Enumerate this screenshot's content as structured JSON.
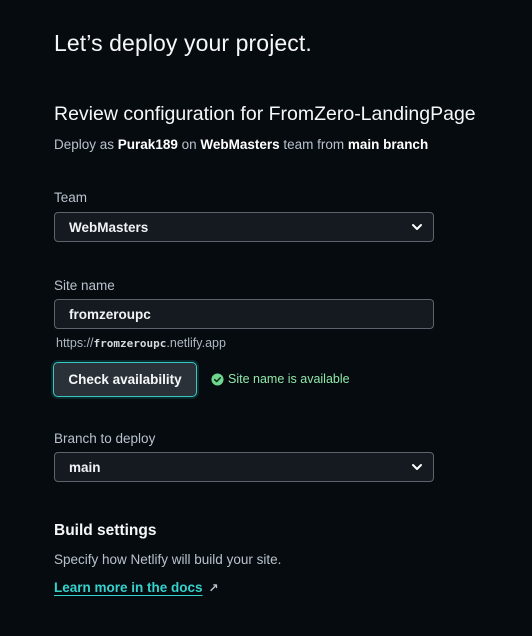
{
  "page": {
    "title": "Let’s deploy your project."
  },
  "review": {
    "heading": "Review configuration for FromZero-LandingPage",
    "deploy_prefix": "Deploy as ",
    "user": "Purak189",
    "on_text": " on ",
    "team": "WebMasters",
    "team_from_text": " team from ",
    "branch_text": "main branch"
  },
  "team_field": {
    "label": "Team",
    "value": "WebMasters",
    "icon": "chevron-down-icon"
  },
  "site_name_field": {
    "label": "Site name",
    "value": "fromzeroupc",
    "url_prefix": "https://",
    "url_name": "fromzeroupc",
    "url_suffix": ".netlify.app"
  },
  "check_availability": {
    "button_label": "Check availability",
    "status_text": "Site name is available",
    "status_icon": "check-circle-icon",
    "status_color": "#8fe6a8"
  },
  "branch_field": {
    "label": "Branch to deploy",
    "value": "main",
    "icon": "chevron-down-icon"
  },
  "build_settings": {
    "heading": "Build settings",
    "description": "Specify how Netlify will build your site.",
    "link_text": "Learn more in the docs",
    "link_icon": "↗"
  },
  "colors": {
    "background": "#060b10",
    "accent": "#35d3cd",
    "success": "#8fe6a8"
  }
}
